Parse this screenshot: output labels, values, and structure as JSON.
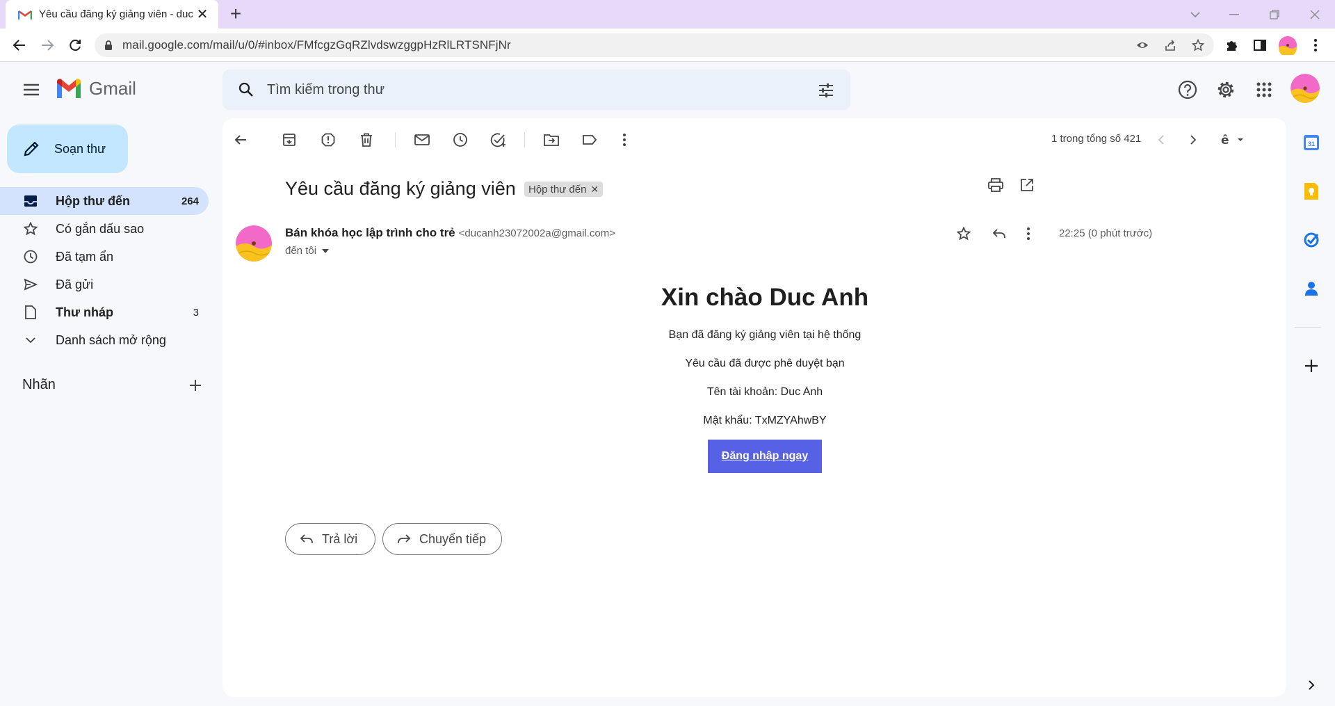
{
  "browser": {
    "tab_title": "Yêu cầu đăng ký giảng viên - duc",
    "url": "mail.google.com/mail/u/0/#inbox/FMfcgzGqRZlvdswzggpHzRlLRTSNFjNr"
  },
  "gmail": {
    "logo_text": "Gmail",
    "search_placeholder": "Tìm kiếm trong thư"
  },
  "sidebar": {
    "compose_label": "Soạn thư",
    "items": [
      {
        "label": "Hộp thư đến",
        "count": "264",
        "icon": "inbox-icon"
      },
      {
        "label": "Có gắn dấu sao",
        "count": "",
        "icon": "star-icon"
      },
      {
        "label": "Đã tạm ẩn",
        "count": "",
        "icon": "clock-icon"
      },
      {
        "label": "Đã gửi",
        "count": "",
        "icon": "send-icon"
      },
      {
        "label": "Thư nháp",
        "count": "3",
        "icon": "draft-icon"
      },
      {
        "label": "Danh sách mở rộng",
        "count": "",
        "icon": "chevron-down-icon"
      }
    ],
    "labels_title": "Nhãn"
  },
  "toolbar": {
    "pager_text": "1 trong tổng số 421"
  },
  "message": {
    "subject": "Yêu cầu đăng ký giảng viên",
    "label_chip": "Hộp thư đến",
    "sender_name": "Bán khóa học lập trình cho trẻ",
    "sender_email": "<ducanh23072002a@gmail.com>",
    "to_text": "đến tôi",
    "timestamp": "22:25 (0 phút trước)",
    "body": {
      "greeting": "Xin chào Duc Anh",
      "lines": [
        "Bạn đã đăng ký giảng viên tại hệ thống",
        "Yêu cầu đã được phê duyệt bạn",
        "Tên tài khoản: Duc Anh",
        "Mật khẩu: TxMZYAhwBY"
      ],
      "button_label": "Đăng nhập ngay"
    },
    "reply_label": "Trả lời",
    "forward_label": "Chuyển tiếp"
  },
  "colors": {
    "tabbar_bg": "#e7d9f9",
    "compose_bg": "#c2e7ff",
    "active_nav_bg": "#d3e3fd",
    "search_bg": "#eaf1fb",
    "login_button_bg": "#5661e5"
  }
}
